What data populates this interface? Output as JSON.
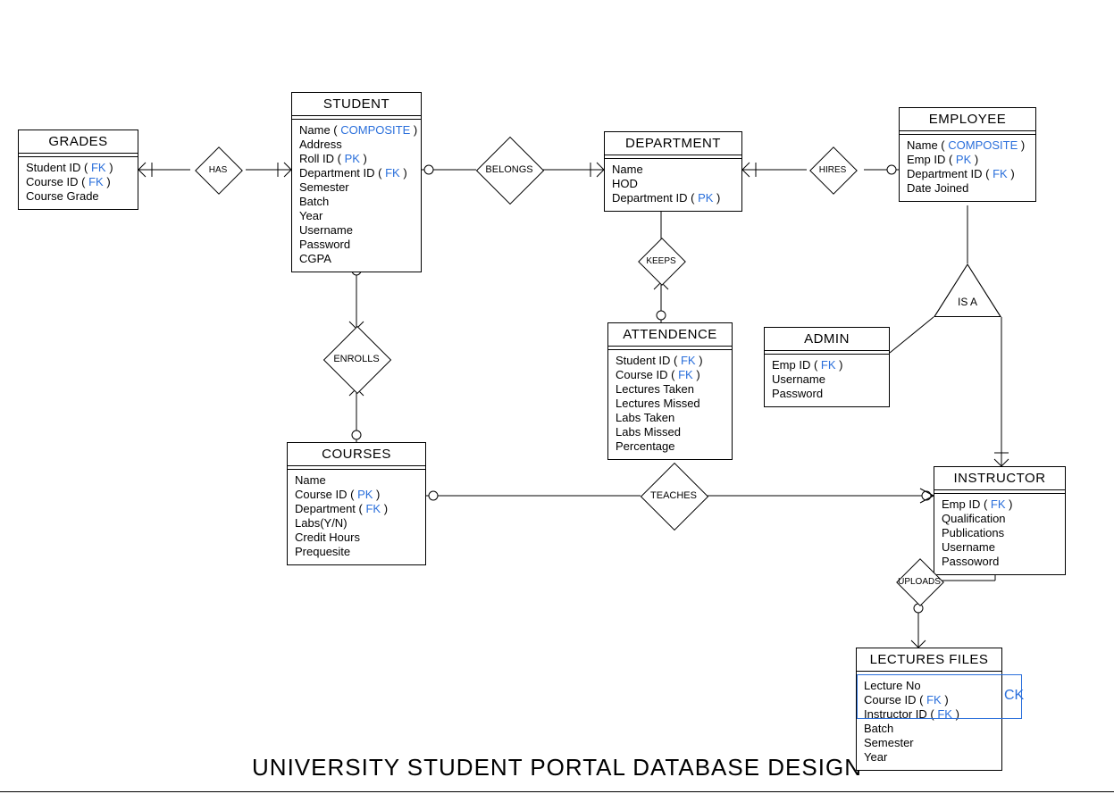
{
  "title": "UNIVERSITY STUDENT PORTAL DATABASE DESIGN",
  "entities": {
    "grades": {
      "title": "GRADES",
      "attrs": [
        {
          "t": "Student ID ( ",
          "k": "FK",
          "s": " )"
        },
        {
          "t": "Course ID ( ",
          "k": "FK",
          "s": " )"
        },
        {
          "t": "Course Grade"
        }
      ]
    },
    "student": {
      "title": "STUDENT",
      "attrs": [
        {
          "t": "Name ( ",
          "k": "COMPOSITE",
          "s": " )"
        },
        {
          "t": "Address"
        },
        {
          "t": "Roll ID ( ",
          "k": "PK",
          "s": " )"
        },
        {
          "t": "Department ID ( ",
          "k": "FK",
          "s": " )"
        },
        {
          "t": "Semester"
        },
        {
          "t": "Batch"
        },
        {
          "t": "Year"
        },
        {
          "t": "Username"
        },
        {
          "t": "Password"
        },
        {
          "t": "CGPA"
        }
      ]
    },
    "department": {
      "title": "DEPARTMENT",
      "attrs": [
        {
          "t": "Name"
        },
        {
          "t": "HOD"
        },
        {
          "t": "Department ID ( ",
          "k": "PK",
          "s": " )"
        }
      ]
    },
    "employee": {
      "title": "EMPLOYEE",
      "attrs": [
        {
          "t": "Name ( ",
          "k": "COMPOSITE",
          "s": " )"
        },
        {
          "t": "Emp ID ( ",
          "k": "PK",
          "s": " )"
        },
        {
          "t": "Department ID ( ",
          "k": "FK",
          "s": " )"
        },
        {
          "t": "Date Joined"
        }
      ]
    },
    "attendence": {
      "title": "ATTENDENCE",
      "attrs": [
        {
          "t": "Student ID ( ",
          "k": "FK",
          "s": " )"
        },
        {
          "t": "Course ID ( ",
          "k": "FK",
          "s": " )"
        },
        {
          "t": "Lectures Taken"
        },
        {
          "t": "Lectures Missed"
        },
        {
          "t": "Labs Taken"
        },
        {
          "t": "Labs Missed"
        },
        {
          "t": "Percentage"
        }
      ]
    },
    "admin": {
      "title": "ADMIN",
      "attrs": [
        {
          "t": "Emp ID ( ",
          "k": "FK",
          "s": " )"
        },
        {
          "t": "Username"
        },
        {
          "t": "Password"
        }
      ]
    },
    "courses": {
      "title": "COURSES",
      "attrs": [
        {
          "t": "Name"
        },
        {
          "t": "Course ID ( ",
          "k": "PK",
          "s": " )"
        },
        {
          "t": "Department ( ",
          "k": "FK",
          "s": " )"
        },
        {
          "t": "Labs(Y/N)"
        },
        {
          "t": "Credit Hours"
        },
        {
          "t": "Prequesite"
        }
      ]
    },
    "instructor": {
      "title": "INSTRUCTOR",
      "attrs": [
        {
          "t": "Emp ID ( ",
          "k": "FK",
          "s": " )"
        },
        {
          "t": "Qualification"
        },
        {
          "t": "Publications"
        },
        {
          "t": "Username"
        },
        {
          "t": "Passoword"
        }
      ]
    },
    "lectures": {
      "title": "LECTURES FILES",
      "attrs": [
        {
          "t": "Lecture No"
        },
        {
          "t": "Course ID ( ",
          "k": "FK",
          "s": " )"
        },
        {
          "t": "Instructor ID ( ",
          "k": "FK",
          "s": " )"
        },
        {
          "t": "Batch"
        },
        {
          "t": "Semester"
        },
        {
          "t": "Year"
        }
      ]
    }
  },
  "relationships": {
    "has": "HAS",
    "belongs": "BELONGS",
    "hires": "HIRES",
    "keeps": "KEEPS",
    "enrolls": "ENROLLS",
    "teaches": "TEACHES",
    "uploads": "UPLOADS",
    "isa": "IS A"
  },
  "ck": "CK"
}
